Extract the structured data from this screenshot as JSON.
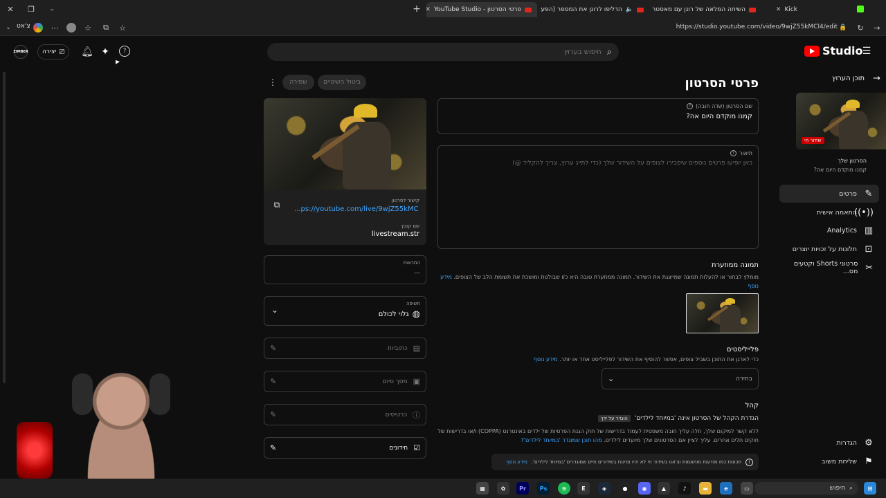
{
  "browser": {
    "tabs": [
      {
        "title": "Kick",
        "active": false
      },
      {
        "title": "השיחה המלאה של רונן עם מאסטר",
        "active": false
      },
      {
        "title": "הדליפו לרונן את המספר (הפע",
        "active": false
      },
      {
        "title": "פרטי הסרטון - YouTube Studio",
        "active": true
      }
    ],
    "url": "https://studio.youtube.com/video/9wjZ55kMCl4/edit",
    "left_button_label": "צ'אט"
  },
  "header": {
    "logo_text": "Studio",
    "search_placeholder": "חיפוש בערוץ",
    "create_label": "יצירה",
    "channel_badge": "ZIMBER"
  },
  "sidebar": {
    "back_label": "תוכן הערוץ",
    "video_live_badge": "שידור חי",
    "video_caption_title": "הסרטון שלך",
    "video_caption_name": "קמנו מוקדם היום אה?",
    "items": [
      {
        "label": "פרטים",
        "icon": "pencil-icon",
        "active": true
      },
      {
        "label": "התאמה אישית",
        "icon": "broadcast-icon",
        "active": false
      },
      {
        "label": "Analytics",
        "icon": "chart-icon",
        "active": false
      },
      {
        "label": "תלונות על זכויות יוצרים",
        "icon": "copyright-icon",
        "active": false
      },
      {
        "label": "סרטוני Shorts וקטעים מס...",
        "icon": "scissors-icon",
        "active": false
      }
    ],
    "settings_label": "הגדרות",
    "feedback_label": "שליחת משוב"
  },
  "page": {
    "title": "פרטי הסרטון",
    "undo_label": "ביטול השינויים",
    "save_label": "שמירה",
    "title_field_label": "שם הסרטון (שדה חובה)",
    "title_field_value": "קמנו מוקדם היום אה?",
    "description_label": "תיאור",
    "description_placeholder": "כאן יופיעו פרטים נוספים שיסבירו לצופים על השידור שלך (כדי לתייג ערוץ, צריך להקליד @)",
    "thumbnail_heading": "תמונה ממוזערת",
    "thumbnail_desc": "מומלץ לבחור או להעלות תמונה שמייצגת את השידור. תמונה ממוזערת טובה היא כזו שבולטת ומושכת את תשומת הלב של הצופים.",
    "thumbnail_more": "מידע נוסף",
    "playlists_heading": "פלייליסטים",
    "playlists_desc": "כדי לארגן את התוכן בשביל צופים, אפשר להוסיף את השידור לפלייליסט אחד או יותר.",
    "playlists_more": "מידע נוסף",
    "playlists_select": "בחירה",
    "audience_heading": "קהל",
    "audience_line": "הגדרת הקהל של הסרטון אינה 'במיוחד לילדים'",
    "audience_badge": "הוגדר על ידך",
    "audience_desc": "ללא קשר למיקום שלך, חלה עליך חובה משפטית לעמוד בדרישות של חוק הגנת הפרטיות של ילדים באינטרנט (COPPA) ו/או בדרישות של חוקים חלים אחרים. עליך לציין אם הסרטונים שלך מיועדים לילדים.",
    "audience_desc_link": "מהו תוכן שמוגדר 'במיוחד לילדים'?",
    "info_notice": "תכונות כמו מודעות מותאמות וצ'אט בשידור חי לא יהיו זמינות בשידורים חיים שמוגדרים 'במיוחד לילדים'.",
    "info_notice_link": "מידע נוסף"
  },
  "right_column": {
    "video_link_label": "קישור לסרטון",
    "video_link": "...ps://youtube.com/live/9wjZ55kMCl4",
    "file_name_label": "שם קובץ",
    "file_name": "livestream.str",
    "notifications_label": "התראות",
    "notifications_value": "—",
    "visibility_label": "חשיפה",
    "visibility_value": "גלוי לכולם",
    "subtitles_label": "כתוביות",
    "end_screen_label": "מסך סיום",
    "cards_label": "כרטיסים",
    "quizzes_label": "חידונים"
  },
  "taskbar": {
    "search_label": "חיפוש"
  }
}
